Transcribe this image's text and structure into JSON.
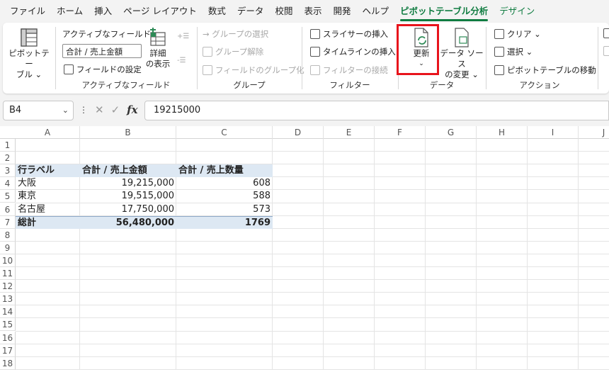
{
  "tabs": [
    "ファイル",
    "ホーム",
    "挿入",
    "ページ レイアウト",
    "数式",
    "データ",
    "校閲",
    "表示",
    "開発",
    "ヘルプ",
    "ピボットテーブル分析",
    "デザイン"
  ],
  "ribbon": {
    "pivottable": {
      "label_line1": "ピボットテー",
      "label_line2": "ブル ⌄"
    },
    "active_field": {
      "title": "アクティブなフィールド:",
      "value": "合計 / 売上金額",
      "settings": "フィールドの設定",
      "detail_line1": "詳細",
      "detail_line2": "の表示",
      "group_label": "アクティブなフィールド"
    },
    "group": {
      "select": "→ グループの選択",
      "ungroup": "グループ解除",
      "field_group": "フィールドのグループ化",
      "group_label": "グループ"
    },
    "filter": {
      "slicer": "スライサーの挿入",
      "timeline": "タイムラインの挿入",
      "connection": "フィルターの接続",
      "group_label": "フィルター"
    },
    "data": {
      "refresh_line1": "更新",
      "refresh_line2": "⌄",
      "source_line1": "データ ソース",
      "source_line2": "の変更 ⌄",
      "group_label": "データ"
    },
    "action": {
      "clear": "クリア ⌄",
      "select": "選択 ⌄",
      "move": "ピボットテーブルの移動",
      "group_label": "アクション"
    }
  },
  "formula_bar": {
    "name_box": "B4",
    "formula": "19215000",
    "fx": "fx"
  },
  "columns": [
    "A",
    "B",
    "C",
    "D",
    "E",
    "F",
    "G",
    "H",
    "I",
    "J"
  ],
  "rows": [
    "1",
    "2",
    "3",
    "4",
    "5",
    "6",
    "7",
    "8",
    "9",
    "10",
    "11",
    "12",
    "13",
    "14",
    "15",
    "16",
    "17",
    "18"
  ],
  "pivot": {
    "header": [
      "行ラベル",
      "合計 / 売上金額",
      "合計 / 売上数量"
    ],
    "rows": [
      [
        "大阪",
        "19,215,000",
        "608"
      ],
      [
        "東京",
        "19,515,000",
        "588"
      ],
      [
        "名古屋",
        "17,750,000",
        "573"
      ]
    ],
    "total": [
      "総計",
      "56,480,000",
      "1769"
    ]
  },
  "colors": {
    "accent": "#107c41",
    "highlight": "#e8141c",
    "pivot_header": "#dde8f3"
  }
}
